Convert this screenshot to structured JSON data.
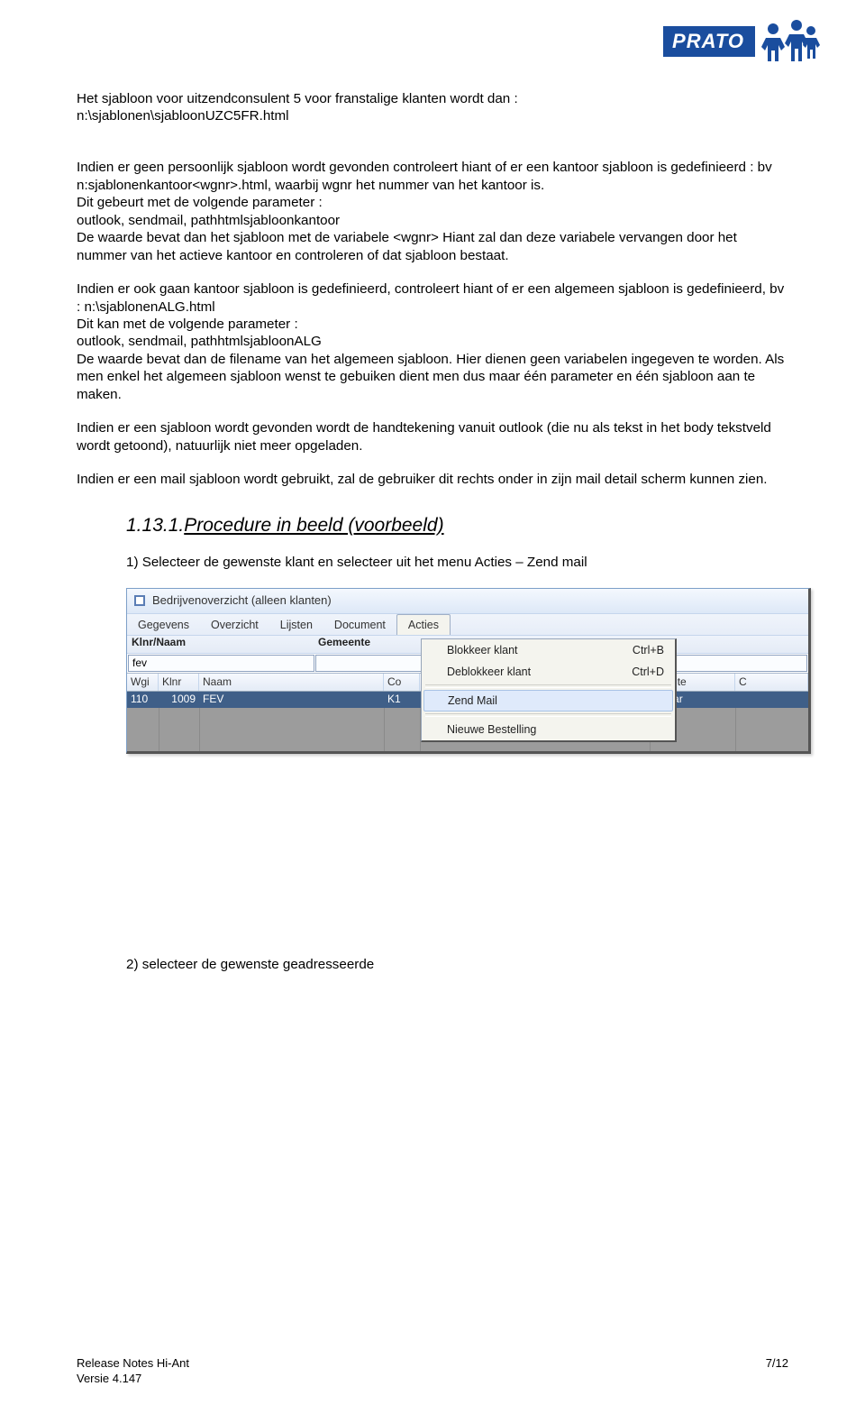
{
  "logo": {
    "text": "PRATO"
  },
  "p1a": "Het sjabloon voor uitzendconsulent 5 voor franstalige klanten wordt dan :",
  "p1b": "n:\\sjablonen\\sjabloonUZC5FR.html",
  "p2a": "Indien er geen persoonlijk sjabloon wordt gevonden controleert hiant of er een kantoor sjabloon is gedefinieerd : bv n:sjablonenkantoor<wgnr>.html, waarbij wgnr het nummer van het kantoor is.",
  "p2b": "Dit gebeurt met de volgende parameter :",
  "p2c": "outlook, sendmail, pathhtmlsjabloonkantoor",
  "p2d": "De waarde bevat dan het sjabloon met de variabele <wgnr> Hiant zal dan deze variabele vervangen door het nummer van het actieve kantoor en controleren of dat sjabloon bestaat.",
  "p3a": "Indien er ook gaan kantoor sjabloon is gedefinieerd, controleert hiant of er een algemeen sjabloon is gedefinieerd, bv : n:\\sjablonenALG.html",
  "p3b": "Dit kan met de volgende parameter :",
  "p3c": "outlook, sendmail, pathhtmlsjabloonALG",
  "p3d": "De waarde bevat dan de filename van het algemeen sjabloon. Hier dienen geen variabelen ingegeven te worden. Als men enkel het algemeen sjabloon wenst te gebuiken dient men dus maar één parameter en één sjabloon aan te maken.",
  "p4": "Indien er een sjabloon wordt gevonden wordt de handtekening vanuit outlook (die nu als tekst in het body tekstveld wordt getoond), natuurlijk niet meer opgeladen.",
  "p5": "Indien er een mail sjabloon wordt gebruikt, zal de gebruiker dit rechts onder in zijn mail detail scherm kunnen zien.",
  "heading": {
    "num": "1.13.1.",
    "text": "Procedure in beeld (voorbeeld)"
  },
  "step1": "1) Selecteer de gewenste klant en selecteer uit het menu Acties – Zend mail",
  "step2": "2) selecteer de gewenste geadresseerde",
  "screenshot": {
    "title": "Bedrijvenoverzicht (alleen klanten)",
    "menu": [
      "Gegevens",
      "Overzicht",
      "Lijsten",
      "Document",
      "Acties"
    ],
    "active_menu_index": 4,
    "filter_headers": [
      "Klnr/Naam",
      "Gemeente"
    ],
    "filter_value": "fev",
    "table_headers": [
      "Wgi",
      "Klnr",
      "Naam",
      "Co",
      "",
      "neente",
      "C"
    ],
    "row": {
      "wgi": "110",
      "klnr": "1009",
      "naam": "FEV",
      "co": "K1",
      "tail1": "",
      "tail2": "selaar",
      "tail3": ""
    },
    "dropdown": [
      {
        "label": "Blokkeer klant",
        "shortcut": "Ctrl+B",
        "sel": false
      },
      {
        "label": "Deblokkeer klant",
        "shortcut": "Ctrl+D",
        "sel": false
      },
      {
        "label": "Zend Mail",
        "shortcut": "",
        "sel": true
      },
      {
        "label": "Nieuwe Bestelling",
        "shortcut": "",
        "sel": false
      }
    ]
  },
  "footer": {
    "l1": "Release Notes Hi-Ant",
    "l2": "Versie 4.147",
    "r": "7/12"
  }
}
